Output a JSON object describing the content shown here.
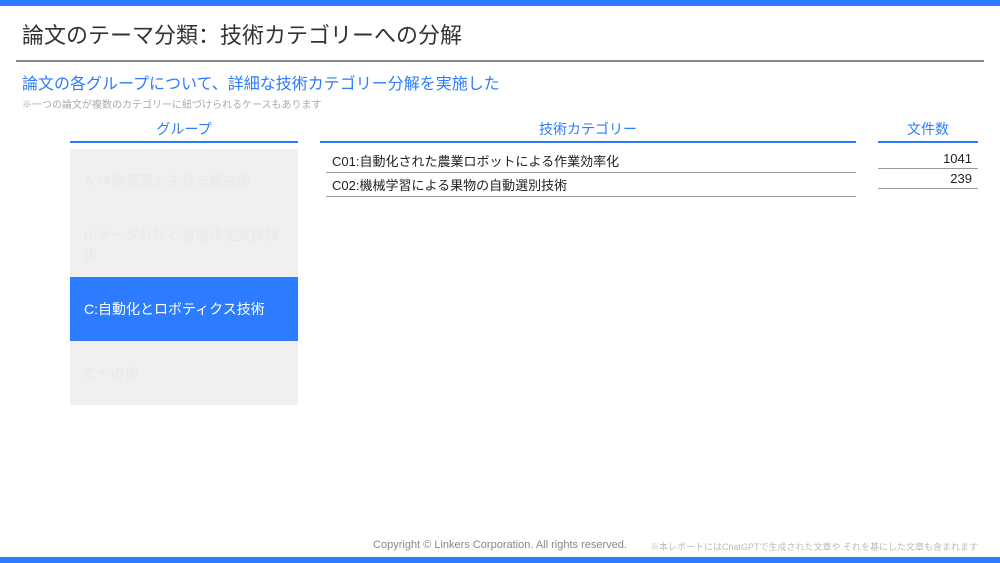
{
  "title": "論文のテーマ分類：技術カテゴリーへの分解",
  "subtitle": "論文の各グループについて、詳細な技術カテゴリー分解を実施した",
  "note": "※一つの論文が複数のカテゴリーに紐づけられるケースもあります",
  "headers": {
    "group": "グループ",
    "category": "技術カテゴリー",
    "count": "文件数"
  },
  "tabs": [
    {
      "label": "A:作物管理と生育支援技術",
      "active": false
    },
    {
      "label": "B:データ分析と意思決定支援技術",
      "active": false
    },
    {
      "label": "C:自動化とロボティクス技術",
      "active": true
    },
    {
      "label": "Z:その他",
      "active": false
    }
  ],
  "rows": [
    {
      "category": "C01:自動化された農業ロボットによる作業効率化",
      "count": "1041"
    },
    {
      "category": "C02:機械学習による果物の自動選別技術",
      "count": "239"
    }
  ],
  "footer": "Copyright © Linkers Corporation. All rights reserved.",
  "disclaimer": "※本レポートにはChatGPTで生成された文章や それを基にした文章も含まれます"
}
